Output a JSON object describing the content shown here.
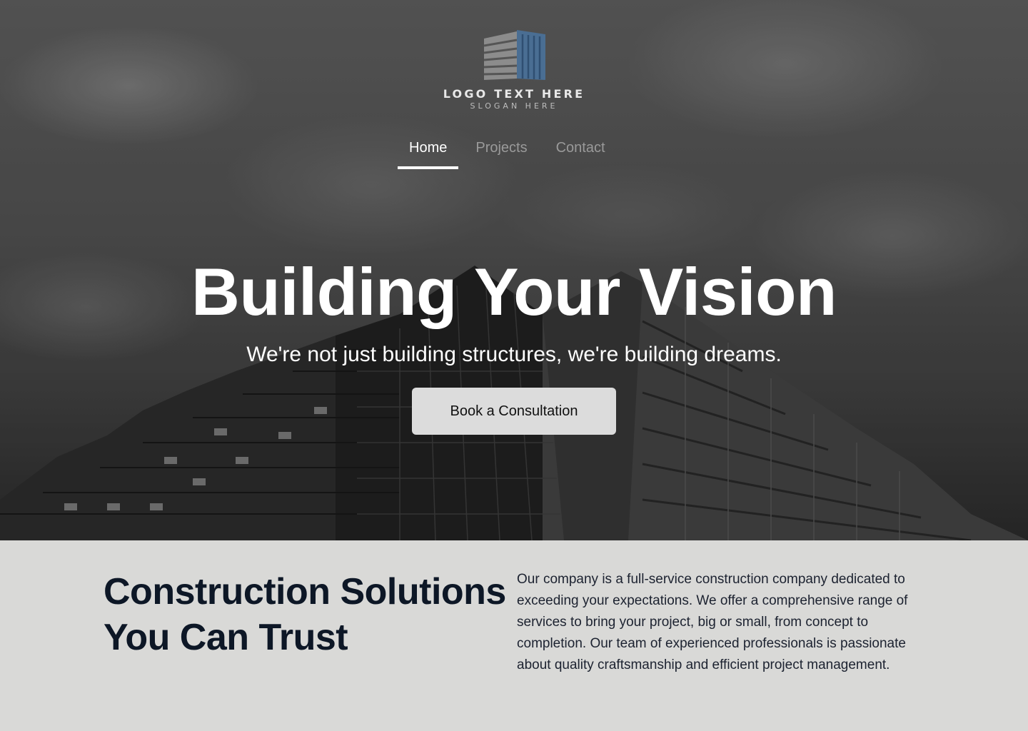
{
  "brand": {
    "logo_text": "LOGO TEXT HERE",
    "slogan": "SLOGAN HERE",
    "logo_colors": {
      "gray": "#8c8c8c",
      "blue": "#4a6e93"
    }
  },
  "nav": {
    "items": [
      {
        "label": "Home",
        "active": true
      },
      {
        "label": "Projects",
        "active": false
      },
      {
        "label": "Contact",
        "active": false
      }
    ]
  },
  "hero": {
    "title": "Building Your Vision",
    "subtitle": "We're not just building structures, we're building dreams.",
    "cta_label": "Book a Consultation"
  },
  "about": {
    "title": "Construction Solutions You Can Trust",
    "body": "Our company is a full-service construction company dedicated to exceeding your expectations. We offer a comprehensive range of services to bring your project, big or small, from concept to completion. Our team of experienced professionals is passionate about quality craftsmanship and efficient project management."
  },
  "colors": {
    "accent_dark": "#0d1726",
    "section_bg": "#d9d9d7",
    "button_bg": "#dcdcdc"
  }
}
